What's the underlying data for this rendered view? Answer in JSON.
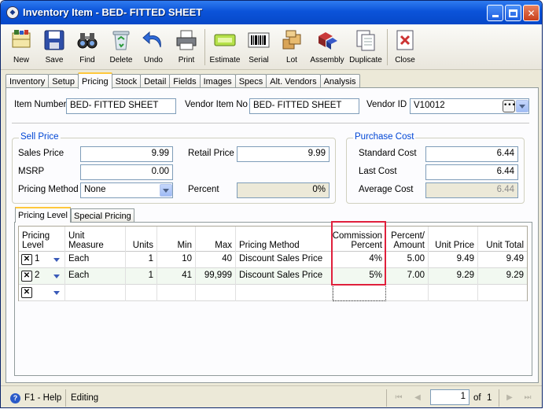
{
  "window": {
    "title": "Inventory Item - BED- FITTED SHEET"
  },
  "toolbar": {
    "new": "New",
    "save": "Save",
    "find": "Find",
    "delete": "Delete",
    "undo": "Undo",
    "print": "Print",
    "estimate": "Estimate",
    "serial": "Serial",
    "lot": "Lot",
    "assembly": "Assembly",
    "duplicate": "Duplicate",
    "close": "Close"
  },
  "tabs": [
    "Inventory",
    "Setup",
    "Pricing",
    "Stock",
    "Detail",
    "Fields",
    "Images",
    "Specs",
    "Alt. Vendors",
    "Analysis"
  ],
  "active_tab": "Pricing",
  "header": {
    "item_number_label": "Item Number",
    "item_number": "BED- FITTED SHEET",
    "vendor_item_label": "Vendor Item No",
    "vendor_item": "BED- FITTED SHEET",
    "vendor_id_label": "Vendor ID",
    "vendor_id": "V10012"
  },
  "sell_price": {
    "title": "Sell Price",
    "sales_price_label": "Sales Price",
    "sales_price": "9.99",
    "msrp_label": "MSRP",
    "msrp": "0.00",
    "pricing_method_label": "Pricing Method",
    "pricing_method": "None",
    "retail_price_label": "Retail Price",
    "retail_price": "9.99",
    "percent_label": "Percent",
    "percent": "0%"
  },
  "purchase_cost": {
    "title": "Purchase Cost",
    "standard_cost_label": "Standard Cost",
    "standard_cost": "6.44",
    "last_cost_label": "Last Cost",
    "last_cost": "6.44",
    "average_cost_label": "Average Cost",
    "average_cost": "6.44"
  },
  "subtabs": [
    "Pricing Level",
    "Special Pricing"
  ],
  "grid": {
    "headers": {
      "pricing_level": "Pricing Level",
      "unit_measure": "Unit Measure",
      "units": "Units",
      "min": "Min",
      "max": "Max",
      "pricing_method": "Pricing Method",
      "commission_percent": "Commission Percent",
      "percent_amount": "Percent/ Amount",
      "unit_price": "Unit Price",
      "unit_total": "Unit Total"
    },
    "rows": [
      {
        "level": "1",
        "unit_measure": "Each",
        "units": "1",
        "min": "10",
        "max": "40",
        "pricing_method": "Discount Sales Price",
        "commission": "4%",
        "percent_amount": "5.00",
        "unit_price": "9.49",
        "unit_total": "9.49"
      },
      {
        "level": "2",
        "unit_measure": "Each",
        "units": "1",
        "min": "41",
        "max": "99,999",
        "pricing_method": "Discount Sales Price",
        "commission": "5%",
        "percent_amount": "7.00",
        "unit_price": "9.29",
        "unit_total": "9.29"
      }
    ],
    "new_row_x": "✕"
  },
  "status": {
    "help": "F1 - Help",
    "mode": "Editing",
    "page": "1",
    "of_label": "of",
    "total_pages": "1"
  },
  "colors": {
    "titlebar": "#0b53d9",
    "highlight_box": "#e0203c",
    "group_title": "#0046d5"
  }
}
